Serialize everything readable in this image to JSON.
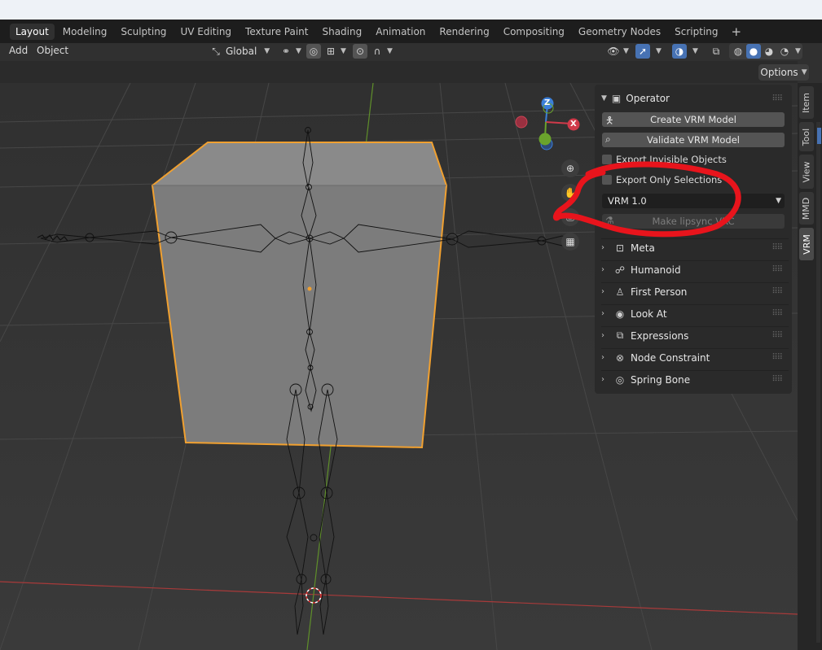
{
  "workspaces": {
    "tabs": [
      "Layout",
      "Modeling",
      "Sculpting",
      "UV Editing",
      "Texture Paint",
      "Shading",
      "Animation",
      "Rendering",
      "Compositing",
      "Geometry Nodes",
      "Scripting"
    ],
    "active": "Layout",
    "add_symbol": "+"
  },
  "header": {
    "menu_add": "Add",
    "menu_object": "Object",
    "orientation": "Global"
  },
  "options_label": "Options",
  "gizmo": {
    "z": "Z",
    "x": "X"
  },
  "npanel": {
    "operator_title": "Operator",
    "create_button": "Create VRM Model",
    "validate_button": "Validate VRM Model",
    "export_invisible": "Export Invisible Objects",
    "export_only_selections": "Export Only Selections",
    "version_select": "VRM 1.0",
    "lipsync_button": "Make lipsync VRC",
    "panels": [
      "Meta",
      "Humanoid",
      "First Person",
      "Look At",
      "Expressions",
      "Node Constraint",
      "Spring Bone"
    ]
  },
  "sidebar_tabs": [
    "Item",
    "Tool",
    "View",
    "MMD",
    "VRM"
  ],
  "sidebar_active": "VRM",
  "colors": {
    "selection_outline": "#f0a030",
    "annotation": "#e8141c",
    "accent": "#4772b3"
  }
}
